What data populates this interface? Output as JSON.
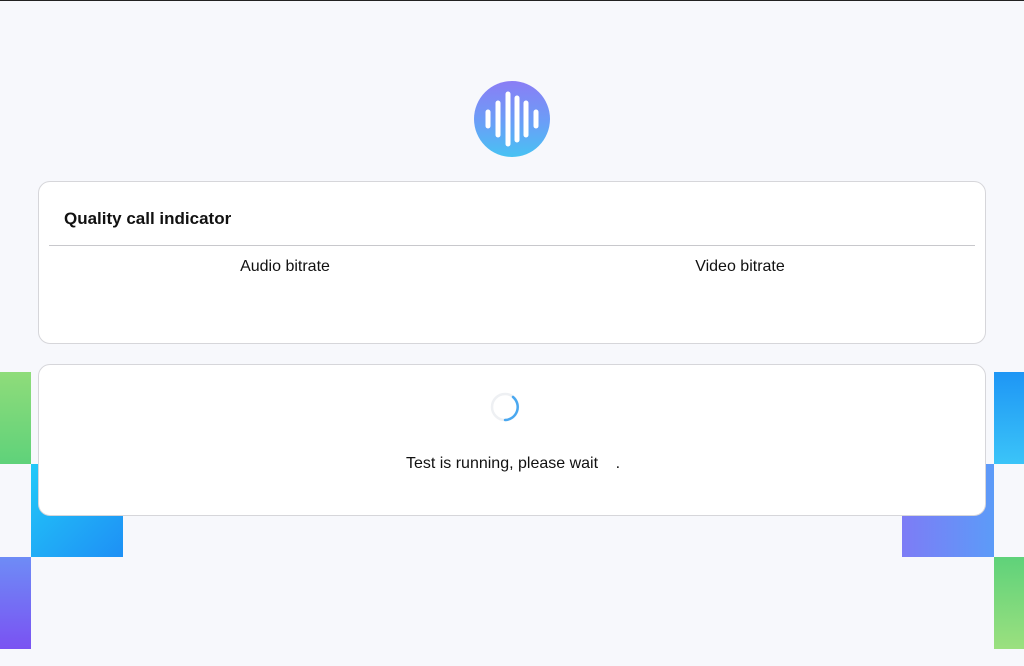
{
  "quality_card": {
    "title": "Quality call indicator",
    "audio_label": "Audio bitrate",
    "video_label": "Video bitrate"
  },
  "status_card": {
    "message": "Test is running, please wait",
    "dots": "."
  },
  "icons": {
    "logo": "sound-wave-icon",
    "spinner": "loading-spinner-icon"
  },
  "colors": {
    "background": "#f7f8fc",
    "logo_gradient_top": "#8a7df5",
    "logo_gradient_bottom": "#48c2f3",
    "spinner": "#4aa8f0",
    "deco_green": "#7bd97f",
    "deco_blue": "#2ab1f6",
    "deco_purple": "#7b6ff5"
  }
}
